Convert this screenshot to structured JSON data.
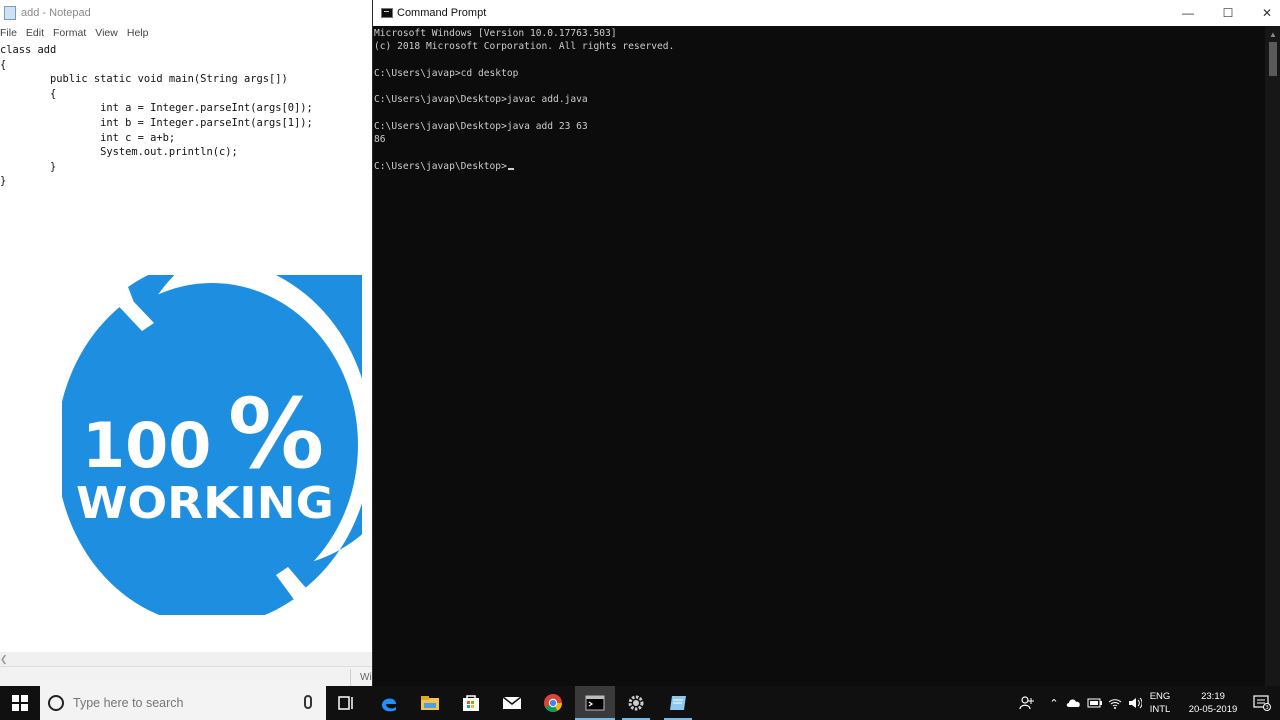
{
  "notepad": {
    "title": "add - Notepad",
    "menu": [
      "File",
      "Edit",
      "Format",
      "View",
      "Help"
    ],
    "code": "class add\n{\n        public static void main(String args[])\n        {\n                int a = Integer.parseInt(args[0]);\n                int b = Integer.parseInt(args[1]);\n                int c = a+b;\n                System.out.println(c);\n        }\n}",
    "status_fragment": "Wi"
  },
  "badge": {
    "number": "100",
    "percent": "%",
    "word": "WORKING",
    "color": "#1e8fe0"
  },
  "cmd": {
    "title": "Command Prompt",
    "lines": [
      "Microsoft Windows [Version 10.0.17763.503]",
      "(c) 2018 Microsoft Corporation. All rights reserved.",
      "",
      "C:\\Users\\javap>cd desktop",
      "",
      "C:\\Users\\javap\\Desktop>javac add.java",
      "",
      "C:\\Users\\javap\\Desktop>java add 23 63",
      "86",
      "",
      "C:\\Users\\javap\\Desktop>"
    ],
    "controls": {
      "minimize": "—",
      "maximize": "☐",
      "close": "✕"
    }
  },
  "taskbar": {
    "search_placeholder": "Type here to search",
    "apps": [
      {
        "name": "task-view-icon"
      },
      {
        "name": "edge-icon"
      },
      {
        "name": "file-explorer-icon"
      },
      {
        "name": "store-icon"
      },
      {
        "name": "mail-icon"
      },
      {
        "name": "chrome-icon"
      },
      {
        "name": "command-prompt-icon"
      },
      {
        "name": "settings-icon"
      },
      {
        "name": "notepad-icon"
      }
    ],
    "tray": {
      "lang_top": "ENG",
      "lang_bottom": "INTL",
      "time": "23:19",
      "date": "20-05-2019",
      "notification_count": "3"
    }
  }
}
